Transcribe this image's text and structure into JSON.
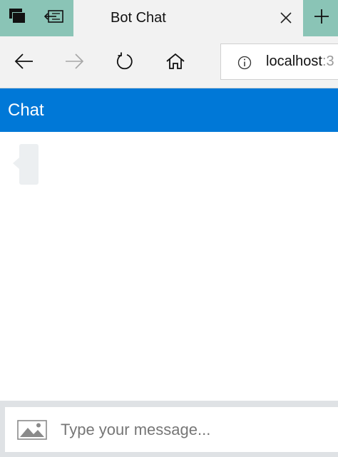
{
  "browser": {
    "tab": {
      "title": "Bot Chat"
    },
    "address": {
      "url": "localhost",
      "url_cut": ":3"
    }
  },
  "chat": {
    "title": "Chat",
    "composer": {
      "placeholder": "Type your message..."
    }
  },
  "icons": {
    "tab_switcher": "tab-switcher-icon",
    "set_aside_tabs": "set-aside-tabs-icon",
    "close_tab": "close-icon",
    "new_tab": "plus-icon",
    "back": "arrow-left-icon",
    "forward": "arrow-right-icon",
    "refresh": "refresh-icon",
    "home": "home-icon",
    "site_info": "info-icon",
    "upload": "image-upload-icon"
  },
  "colors": {
    "tab_strip": "#8ac4b6",
    "toolbar": "#f2f2f2",
    "chat_header": "#0078d7",
    "bubble": "#eceff1",
    "composer_frame": "#dfe2e5"
  }
}
